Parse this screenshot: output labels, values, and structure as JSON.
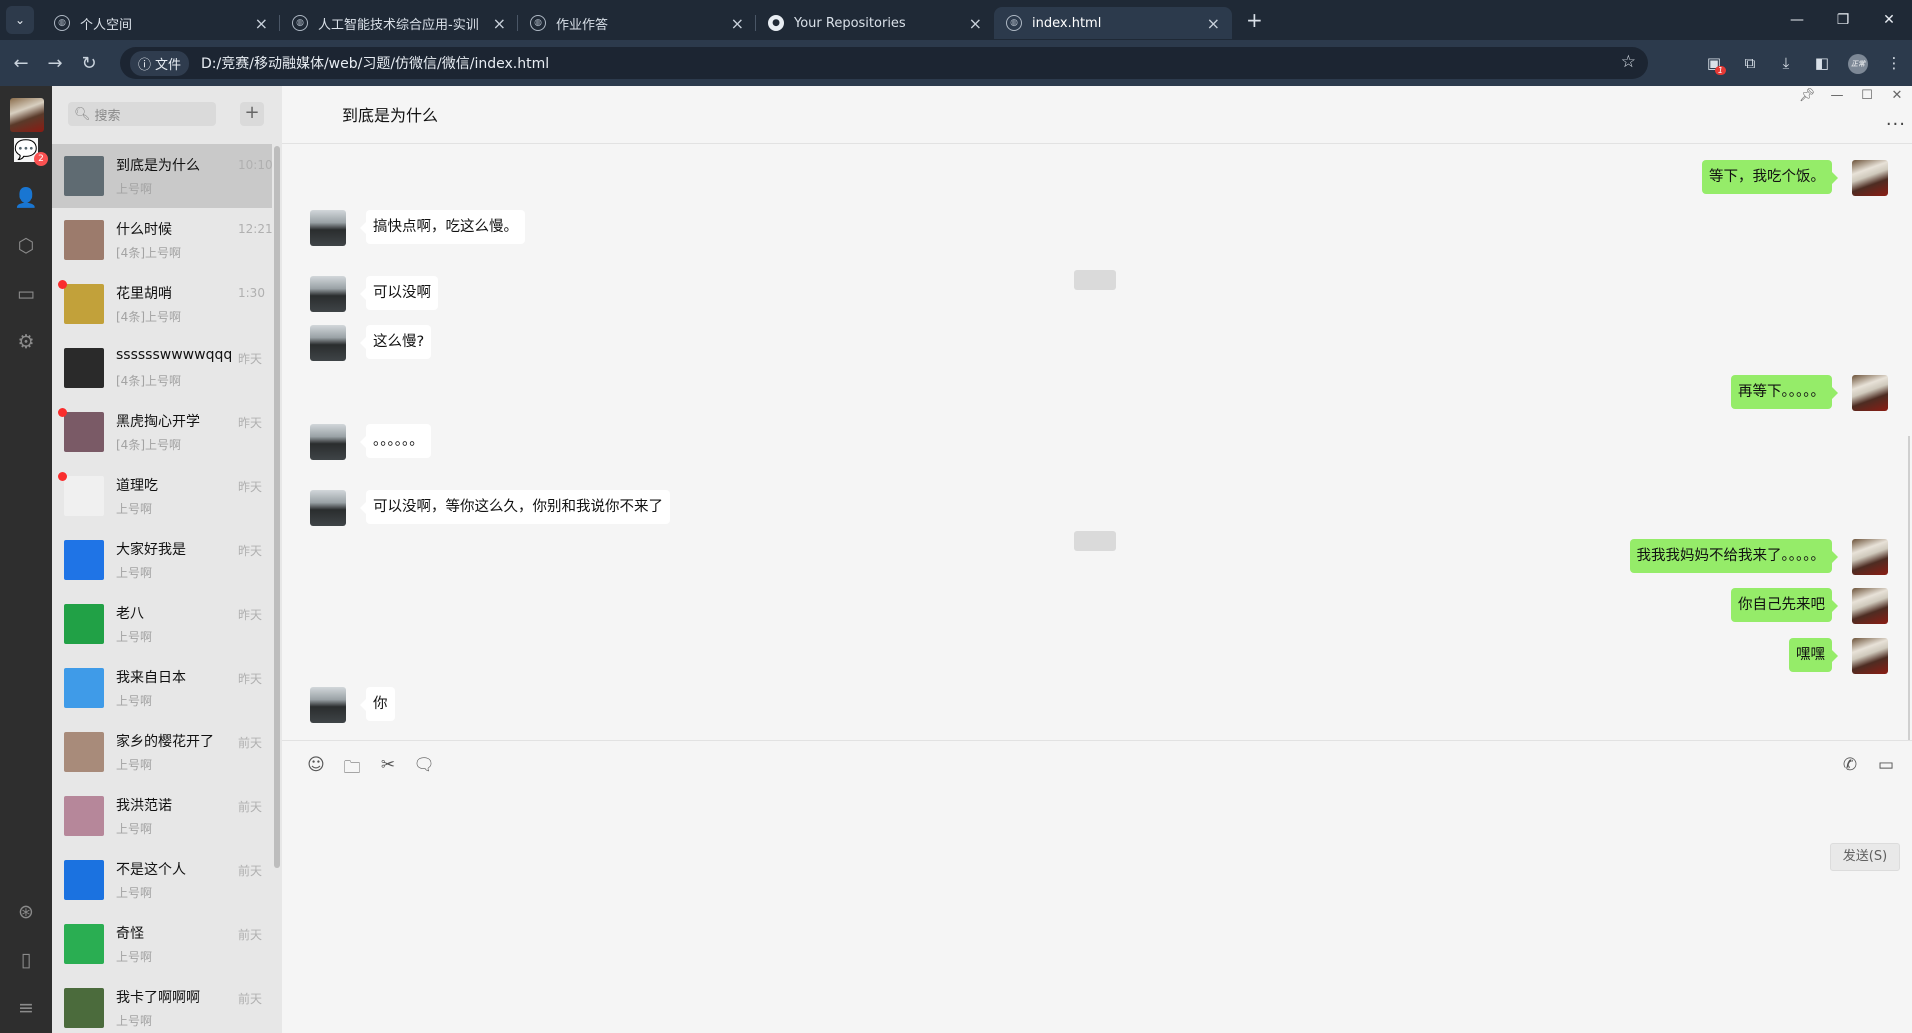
{
  "browser": {
    "tabs": [
      {
        "title": "个人空间",
        "icon": "globe-icon"
      },
      {
        "title": "人工智能技术综合应用-实训",
        "icon": "globe-icon"
      },
      {
        "title": "作业作答",
        "icon": "globe-icon"
      },
      {
        "title": "Your Repositories",
        "icon": "github-icon"
      },
      {
        "title": "index.html",
        "icon": "globe-icon"
      }
    ],
    "address": {
      "chip_label": "文件",
      "url": "D:/竞赛/移动融媒体/web/习题/仿微信/微信/index.html"
    },
    "extension_badge": "1",
    "profile_label": "正常"
  },
  "rail": {
    "chat_badge": "2",
    "icons": [
      "chat-icon",
      "contacts-icon",
      "box-icon",
      "folder-icon",
      "settings-icon",
      "miniprogram-icon",
      "phone-icon",
      "menu-icon"
    ]
  },
  "sidebar": {
    "search_placeholder": "搜索",
    "add_label": "+",
    "conversations": [
      {
        "name": "到底是为什么",
        "preview": "上号啊",
        "time": "10:10",
        "unread": false,
        "color": "#5f6b72"
      },
      {
        "name": "什么时候",
        "preview": "[4条]上号啊",
        "time": "12:21",
        "unread": false,
        "color": "#9c7b6c"
      },
      {
        "name": "花里胡哨",
        "preview": "[4条]上号啊",
        "time": "1:30",
        "unread": true,
        "color": "#c2a13a"
      },
      {
        "name": "sssssswwwwqqq",
        "preview": "[4条]上号啊",
        "time": "昨天",
        "unread": false,
        "color": "#2a2a2a"
      },
      {
        "name": "黑虎掏心开学",
        "preview": "[4条]上号啊",
        "time": "昨天",
        "unread": true,
        "color": "#7a5a66"
      },
      {
        "name": "道理吃",
        "preview": "上号啊",
        "time": "昨天",
        "unread": true,
        "color": "#f0f0f0"
      },
      {
        "name": "大家好我是",
        "preview": "上号啊",
        "time": "昨天",
        "unread": false,
        "color": "#1f74e6"
      },
      {
        "name": "老八",
        "preview": "上号啊",
        "time": "昨天",
        "unread": false,
        "color": "#21a146"
      },
      {
        "name": "我来自日本",
        "preview": "上号啊",
        "time": "昨天",
        "unread": false,
        "color": "#3f9be8"
      },
      {
        "name": "家乡的樱花开了",
        "preview": "上号啊",
        "time": "前天",
        "unread": false,
        "color": "#a88b7a"
      },
      {
        "name": "我洪范诺",
        "preview": "上号啊",
        "time": "前天",
        "unread": false,
        "color": "#b6879a"
      },
      {
        "name": "不是这个人",
        "preview": "上号啊",
        "time": "前天",
        "unread": false,
        "color": "#1b72e0"
      },
      {
        "name": "奇怪",
        "preview": "上号啊",
        "time": "前天",
        "unread": false,
        "color": "#2aae52"
      },
      {
        "name": "我卡了啊啊啊",
        "preview": "上号啊",
        "time": "前天",
        "unread": false,
        "color": "#4b6b3c"
      }
    ]
  },
  "chat": {
    "title": "到底是为什么",
    "messages": [
      {
        "side": "right",
        "text": "等下，我吃个饭。"
      },
      {
        "side": "left",
        "text": "搞快点啊，吃这么慢。"
      },
      {
        "side": "left",
        "text": "可以没啊"
      },
      {
        "side": "left",
        "text": "这么慢?"
      },
      {
        "side": "right",
        "text": "再等下。。。。。"
      },
      {
        "side": "left",
        "text": "。。。。。。"
      },
      {
        "side": "left",
        "text": "可以没啊，等你这么久，你别和我说你不来了"
      },
      {
        "side": "right",
        "text": "我我我妈妈不给我来了。。。。。"
      },
      {
        "side": "right",
        "text": "你自己先来吧"
      },
      {
        "side": "right",
        "text": "嘿嘿"
      },
      {
        "side": "left",
        "text": "你"
      }
    ],
    "toolbar_icons": [
      "emoji-icon",
      "folder-icon",
      "scissors-icon",
      "chat-history-icon",
      "phone-call-icon",
      "video-call-icon"
    ],
    "send_label": "发送(S)"
  },
  "colors": {
    "accent": "#07c160",
    "bubble_self": "#95ec69",
    "bubble_other": "#ffffff",
    "unread_dot": "#fa2d2d"
  }
}
